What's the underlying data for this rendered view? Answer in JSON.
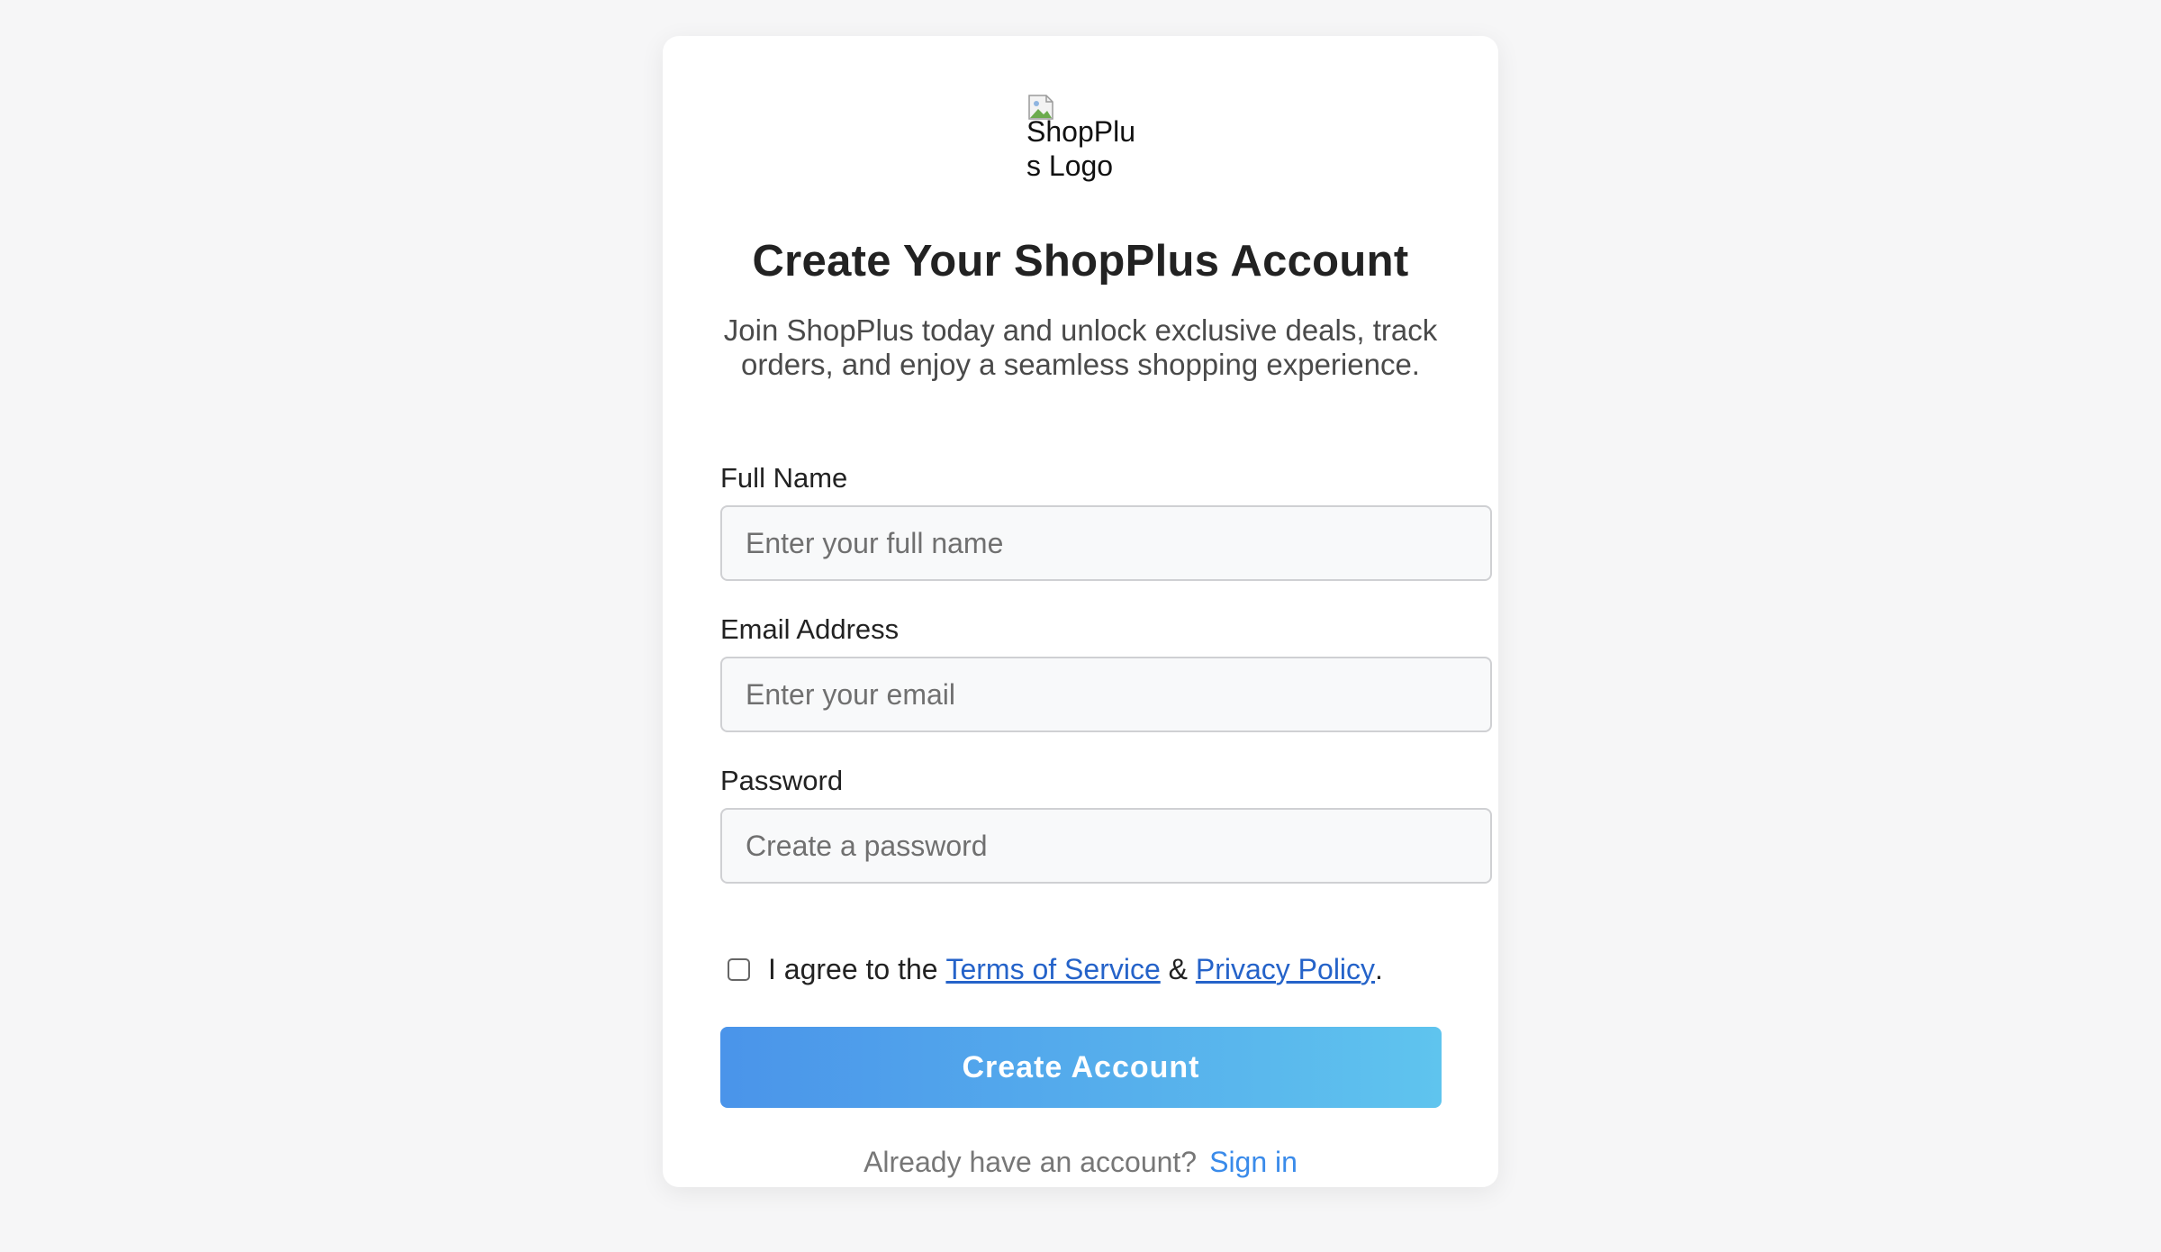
{
  "logo": {
    "alt_text": "ShopPlus Logo",
    "icon": "broken-image-icon"
  },
  "header": {
    "title": "Create Your ShopPlus Account",
    "subtitle": "Join ShopPlus today and unlock exclusive deals, track orders, and enjoy a seamless shopping experience."
  },
  "form": {
    "full_name": {
      "label": "Full Name",
      "placeholder": "Enter your full name",
      "value": ""
    },
    "email": {
      "label": "Email Address",
      "placeholder": "Enter your email",
      "value": ""
    },
    "password": {
      "label": "Password",
      "placeholder": "Create a password",
      "value": ""
    },
    "terms": {
      "checked": false,
      "prefix": "I agree to the",
      "terms_link": "Terms of Service",
      "joiner": "&",
      "privacy_link": "Privacy Policy",
      "suffix": "."
    },
    "submit_label": "Create Account"
  },
  "footer": {
    "prompt": "Already have an account?",
    "signin_link": "Sign in"
  },
  "colors": {
    "page_background": "#f6f6f7",
    "card_background": "#ffffff",
    "button_gradient_start": "#4a94ea",
    "button_gradient_end": "#5fc4ee",
    "link": "#2563c9",
    "signin_link": "#3a8bea"
  }
}
